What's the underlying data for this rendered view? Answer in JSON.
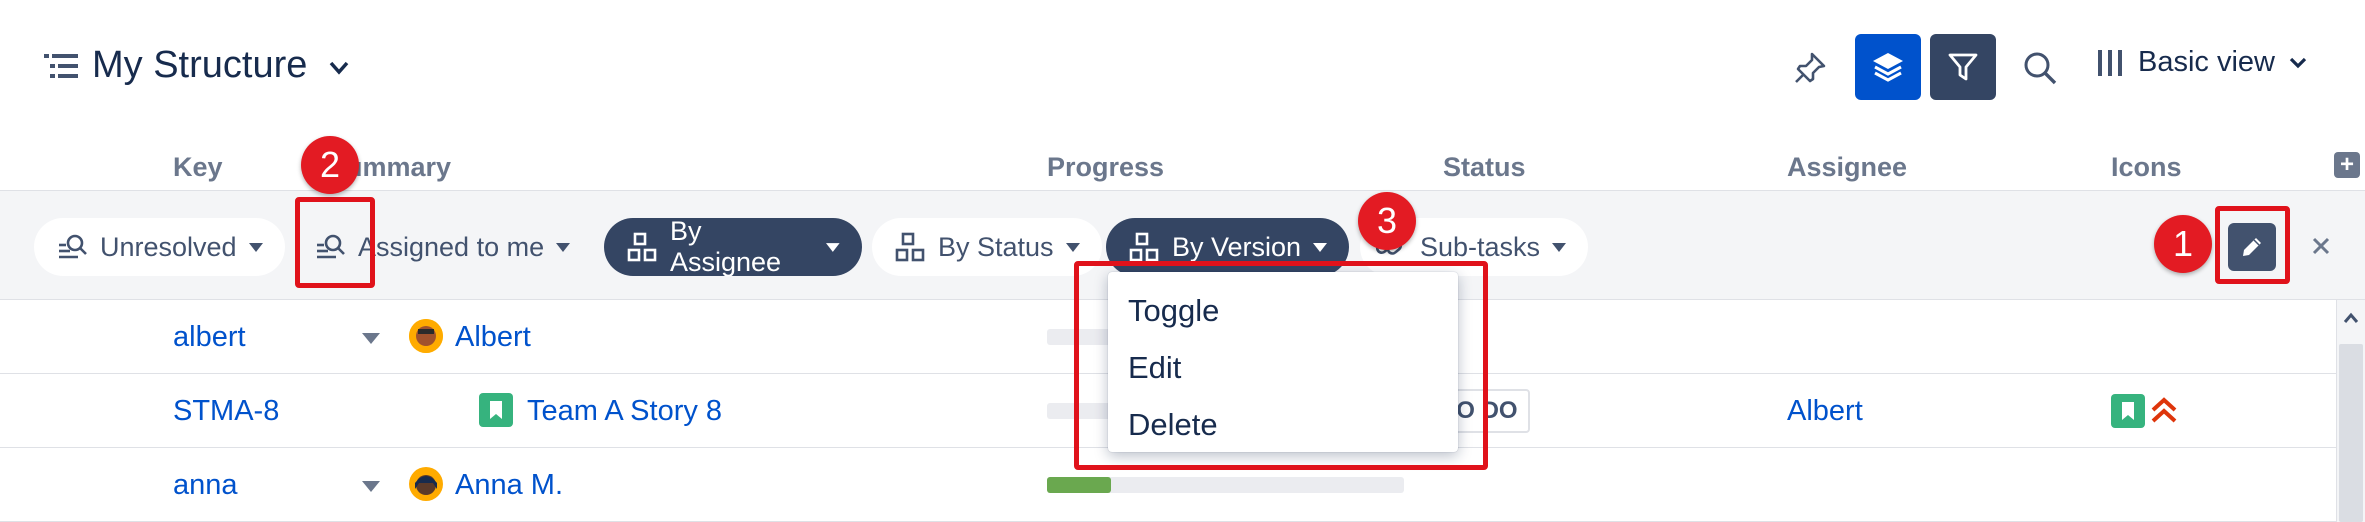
{
  "header": {
    "title": "My Structure",
    "view_label": "Basic view"
  },
  "columns": {
    "key": "Key",
    "summary": "Summary",
    "progress": "Progress",
    "status": "Status",
    "assignee": "Assignee",
    "icons": "Icons",
    "add_column_symbol": "+"
  },
  "filters": {
    "unresolved": "Unresolved",
    "assigned_to_me": "Assigned to me",
    "by_assignee": "By Assignee",
    "by_status": "By Status",
    "by_version": "By Version",
    "sub_tasks": "Sub-tasks"
  },
  "menu": {
    "items": [
      "Toggle",
      "Edit",
      "Delete"
    ]
  },
  "rows": [
    {
      "key": "albert",
      "summary": "Albert",
      "progress": 0.0,
      "status": "",
      "assignee": ""
    },
    {
      "key": "STMA-8",
      "summary": "Team A Story 8",
      "progress": 0.0,
      "status": "TO DO",
      "assignee": "Albert"
    },
    {
      "key": "anna",
      "summary": "Anna M.",
      "progress": 0.18,
      "status": "",
      "assignee": ""
    }
  ],
  "annotations": {
    "badge1": "1",
    "badge2": "2",
    "badge3": "3"
  },
  "colors": {
    "primary_blue": "#0052cc",
    "dark_navy": "#344563",
    "annotation_red": "#e31b23",
    "story_green": "#36b37e",
    "progress_green": "#6aa84f"
  },
  "icons": {
    "title": "structure-list-icon",
    "pin": "pin-icon",
    "layers": "layers-icon",
    "filter": "filter-icon",
    "search": "search-icon",
    "view": "columns-icon",
    "edit": "pencil-icon",
    "close": "close-icon",
    "story": "story-icon",
    "priority": "highest-priority-icon"
  }
}
